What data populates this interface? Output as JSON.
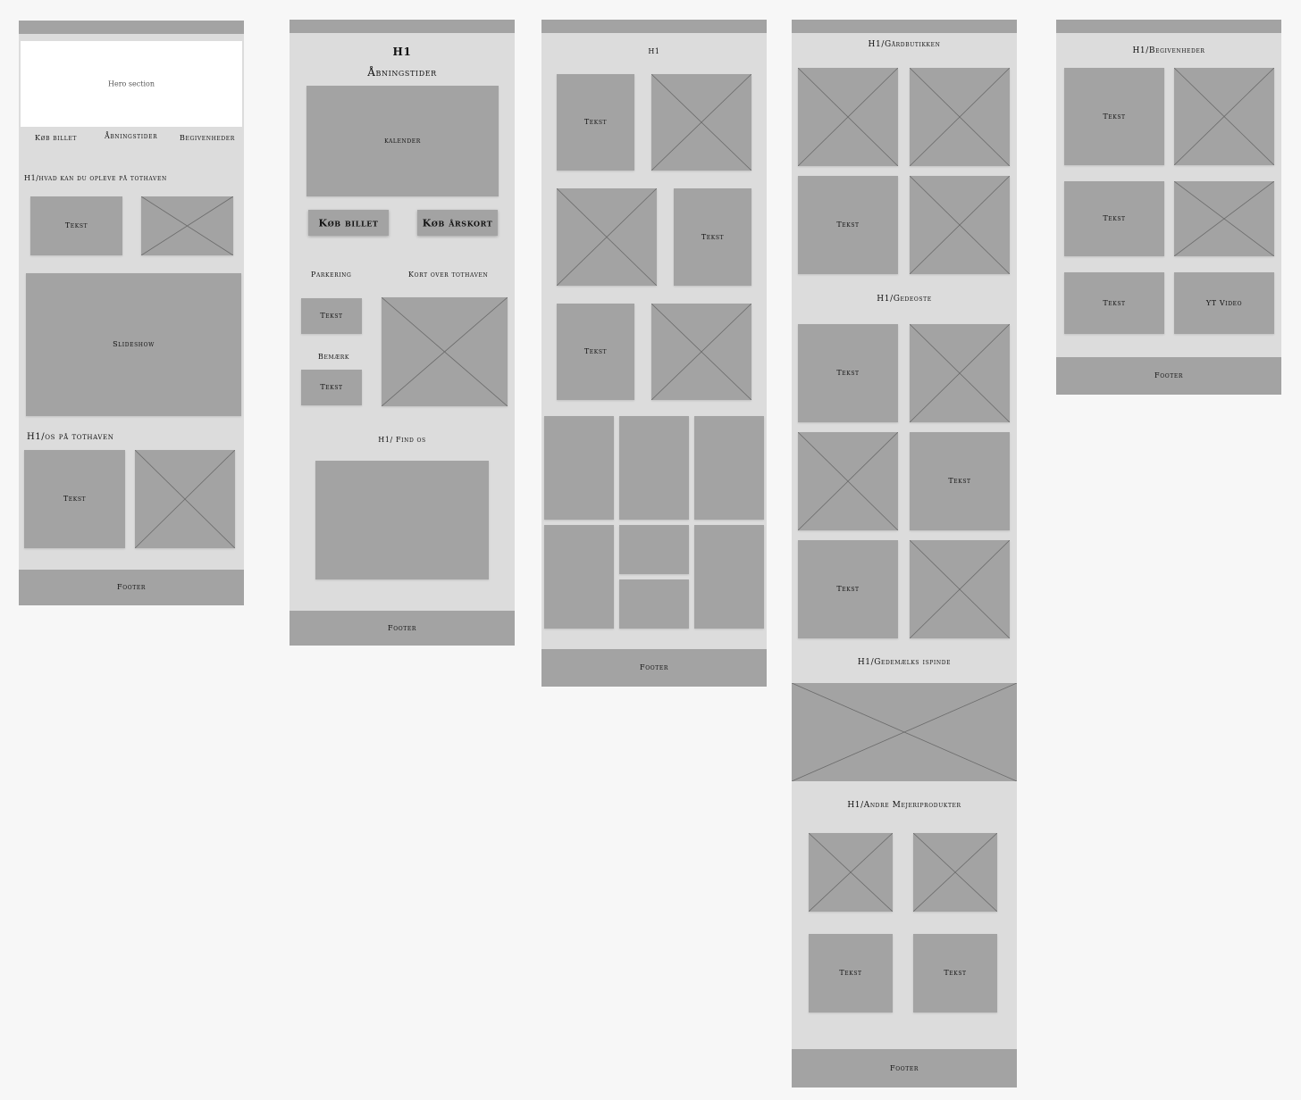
{
  "frame1": {
    "hero": "Hero section",
    "nav": [
      "Køb billet",
      "Åbningstider",
      "Begivenheder"
    ],
    "heading1": "H1/hvad kan du opleve på tothaven",
    "text1": "Tekst",
    "slideshow": "Slideshow",
    "heading2": "H1/os på tothaven",
    "text2": "Tekst",
    "footer": "Footer"
  },
  "frame2": {
    "h1": "H1",
    "subtitle": "Åbningstider",
    "calendar": "kalender",
    "btn_ticket": "Køb billet",
    "btn_card": "Køb årskort",
    "parking": "Parkering",
    "map_label": "Kort over tothaven",
    "text1": "Tekst",
    "note": "Bemærk",
    "text2": "Tekst",
    "find_us": "H1/ Find os",
    "footer": "Footer"
  },
  "frame3": {
    "h1": "H1",
    "texts": [
      "Tekst",
      "Tekst",
      "Tekst"
    ],
    "footer": "Footer"
  },
  "frame4": {
    "heading_shop": "H1/Gårdbutikken",
    "text_shop": "Tekst",
    "heading_cheese": "H1/Gedeoste",
    "cheese_texts": [
      "Tekst",
      "Tekst",
      "Tekst"
    ],
    "heading_icecream": "H1/Gedemælks ispinde",
    "heading_dairy": "H1/Andre Mejeriprodukter",
    "dairy_texts": [
      "Tekst",
      "Tekst"
    ],
    "footer": "Footer"
  },
  "frame5": {
    "heading": "H1/Begivenheder",
    "texts": [
      "Tekst",
      "Tekst",
      "Tekst"
    ],
    "video": "YT Video",
    "footer": "Footer"
  },
  "colors": {
    "canvas": "#f7f7f7",
    "frame": "#dcdcdc",
    "placeholder": "#a3a3a3",
    "hero": "#ffffff"
  }
}
